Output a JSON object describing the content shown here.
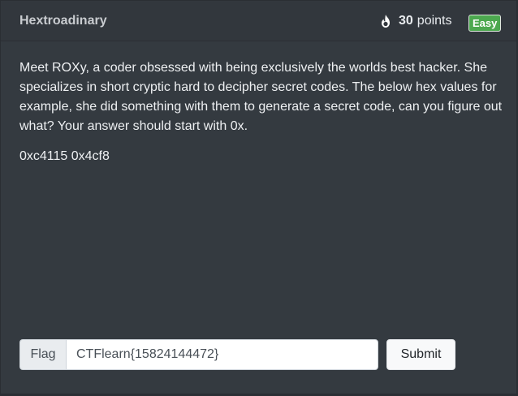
{
  "challenge": {
    "title": "Hextroadinary",
    "points_value": "30",
    "points_label": "points",
    "difficulty": "Easy",
    "description": "Meet ROXy, a coder obsessed with being exclusively the worlds best hacker. She specializes in short cryptic hard to decipher secret codes. The below hex values for example, she did something with them to generate a secret code, can you figure out what? Your answer should start with 0x.",
    "hex_values": "0xc4115 0x4cf8"
  },
  "form": {
    "flag_label": "Flag",
    "flag_value": "CTFlearn{15824144472}",
    "submit_label": "Submit"
  },
  "icons": {
    "points": "fire-icon"
  },
  "colors": {
    "background": "#343a40",
    "badge_easy": "#4ca84f",
    "text": "#eef0f2"
  }
}
